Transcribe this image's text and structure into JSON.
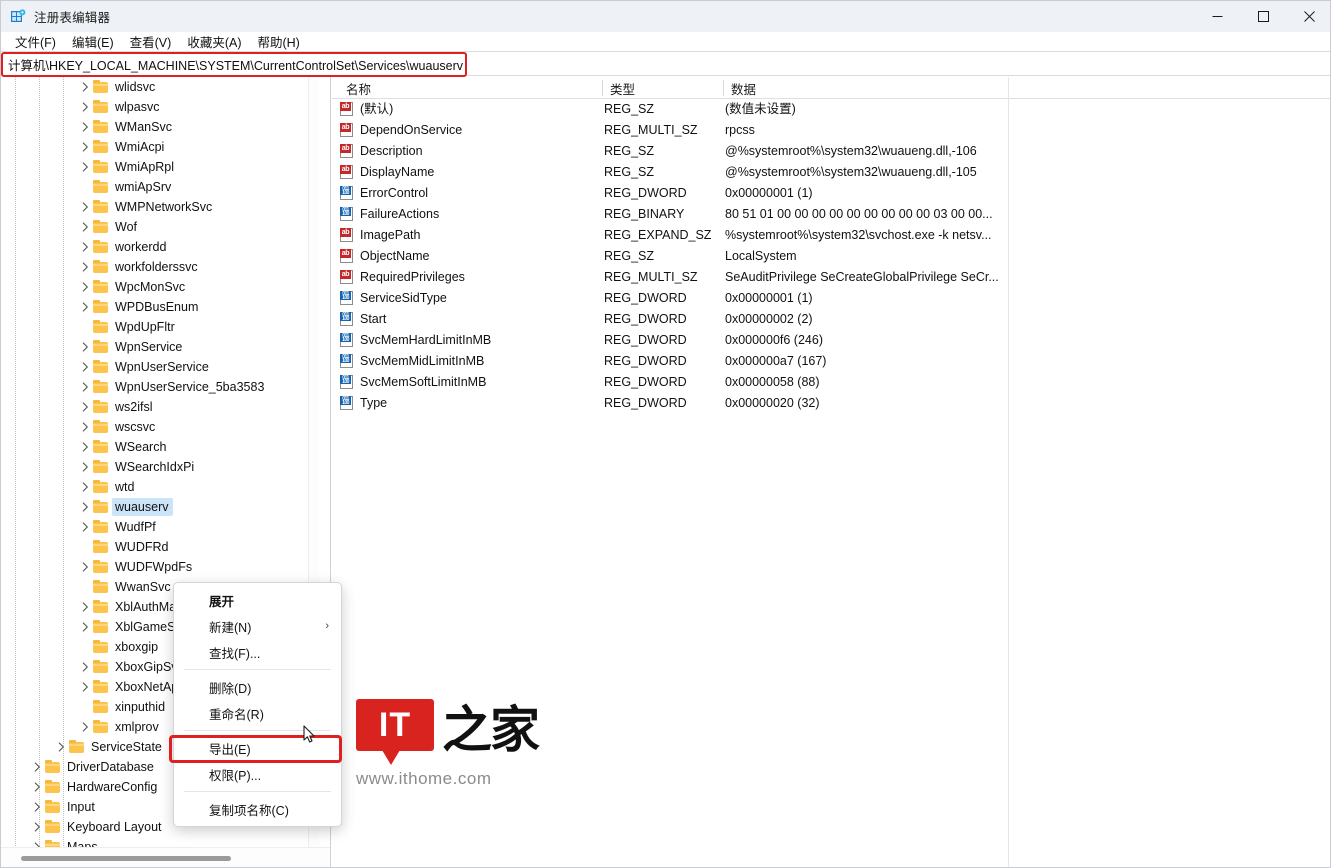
{
  "window": {
    "title": "注册表编辑器",
    "icon": "registry-editor-icon",
    "controls": {
      "minimize": "—",
      "maximize": "▢",
      "close": "✕"
    }
  },
  "menubar": {
    "items": [
      {
        "label": "文件(F)",
        "name": "menu-file"
      },
      {
        "label": "编辑(E)",
        "name": "menu-edit"
      },
      {
        "label": "查看(V)",
        "name": "menu-view"
      },
      {
        "label": "收藏夹(A)",
        "name": "menu-favorites"
      },
      {
        "label": "帮助(H)",
        "name": "menu-help"
      }
    ]
  },
  "address": {
    "value": "计算机\\HKEY_LOCAL_MACHINE\\SYSTEM\\CurrentControlSet\\Services\\wuauserv",
    "placeholder": "",
    "highlight_color": "#e02020"
  },
  "tree": {
    "nodes": [
      {
        "label": "wlidsvc",
        "depth": 3,
        "expandable": true,
        "selected": false
      },
      {
        "label": "wlpasvc",
        "depth": 3,
        "expandable": true,
        "selected": false
      },
      {
        "label": "WManSvc",
        "depth": 3,
        "expandable": true,
        "selected": false
      },
      {
        "label": "WmiAcpi",
        "depth": 3,
        "expandable": true,
        "selected": false
      },
      {
        "label": "WmiApRpl",
        "depth": 3,
        "expandable": true,
        "selected": false
      },
      {
        "label": "wmiApSrv",
        "depth": 3,
        "expandable": false,
        "selected": false
      },
      {
        "label": "WMPNetworkSvc",
        "depth": 3,
        "expandable": true,
        "selected": false
      },
      {
        "label": "Wof",
        "depth": 3,
        "expandable": true,
        "selected": false
      },
      {
        "label": "workerdd",
        "depth": 3,
        "expandable": true,
        "selected": false
      },
      {
        "label": "workfolderssvc",
        "depth": 3,
        "expandable": true,
        "selected": false
      },
      {
        "label": "WpcMonSvc",
        "depth": 3,
        "expandable": true,
        "selected": false
      },
      {
        "label": "WPDBusEnum",
        "depth": 3,
        "expandable": true,
        "selected": false
      },
      {
        "label": "WpdUpFltr",
        "depth": 3,
        "expandable": false,
        "selected": false
      },
      {
        "label": "WpnService",
        "depth": 3,
        "expandable": true,
        "selected": false
      },
      {
        "label": "WpnUserService",
        "depth": 3,
        "expandable": true,
        "selected": false
      },
      {
        "label": "WpnUserService_5ba3583",
        "depth": 3,
        "expandable": true,
        "selected": false
      },
      {
        "label": "ws2ifsl",
        "depth": 3,
        "expandable": true,
        "selected": false
      },
      {
        "label": "wscsvc",
        "depth": 3,
        "expandable": true,
        "selected": false
      },
      {
        "label": "WSearch",
        "depth": 3,
        "expandable": true,
        "selected": false
      },
      {
        "label": "WSearchIdxPi",
        "depth": 3,
        "expandable": true,
        "selected": false
      },
      {
        "label": "wtd",
        "depth": 3,
        "expandable": true,
        "selected": false
      },
      {
        "label": "wuauserv",
        "depth": 3,
        "expandable": true,
        "selected": true
      },
      {
        "label": "WudfPf",
        "depth": 3,
        "expandable": true,
        "selected": false
      },
      {
        "label": "WUDFRd",
        "depth": 3,
        "expandable": false,
        "selected": false
      },
      {
        "label": "WUDFWpdFs",
        "depth": 3,
        "expandable": true,
        "selected": false
      },
      {
        "label": "WwanSvc",
        "depth": 3,
        "expandable": false,
        "selected": false
      },
      {
        "label": "XblAuthManager",
        "depth": 3,
        "expandable": true,
        "selected": false
      },
      {
        "label": "XblGameSave",
        "depth": 3,
        "expandable": true,
        "selected": false
      },
      {
        "label": "xboxgip",
        "depth": 3,
        "expandable": false,
        "selected": false
      },
      {
        "label": "XboxGipSvc",
        "depth": 3,
        "expandable": true,
        "selected": false
      },
      {
        "label": "XboxNetApiSvc",
        "depth": 3,
        "expandable": true,
        "selected": false
      },
      {
        "label": "xinputhid",
        "depth": 3,
        "expandable": false,
        "selected": false
      },
      {
        "label": "xmlprov",
        "depth": 3,
        "expandable": true,
        "selected": false
      },
      {
        "label": "ServiceState",
        "depth": 2,
        "expandable": true,
        "selected": false
      },
      {
        "label": "DriverDatabase",
        "depth": 1,
        "expandable": true,
        "selected": false
      },
      {
        "label": "HardwareConfig",
        "depth": 1,
        "expandable": true,
        "selected": false
      },
      {
        "label": "Input",
        "depth": 1,
        "expandable": true,
        "selected": false
      },
      {
        "label": "Keyboard Layout",
        "depth": 1,
        "expandable": true,
        "selected": false
      },
      {
        "label": "Maps",
        "depth": 1,
        "expandable": true,
        "selected": false
      }
    ]
  },
  "values": {
    "columns": {
      "name": "名称",
      "type": "类型",
      "data": "数据"
    },
    "rows": [
      {
        "name": "(默认)",
        "type": "REG_SZ",
        "data": "(数值未设置)",
        "icon": "string-value-icon"
      },
      {
        "name": "DependOnService",
        "type": "REG_MULTI_SZ",
        "data": "rpcss",
        "icon": "string-value-icon"
      },
      {
        "name": "Description",
        "type": "REG_SZ",
        "data": "@%systemroot%\\system32\\wuaueng.dll,-106",
        "icon": "string-value-icon"
      },
      {
        "name": "DisplayName",
        "type": "REG_SZ",
        "data": "@%systemroot%\\system32\\wuaueng.dll,-105",
        "icon": "string-value-icon"
      },
      {
        "name": "ErrorControl",
        "type": "REG_DWORD",
        "data": "0x00000001 (1)",
        "icon": "binary-value-icon"
      },
      {
        "name": "FailureActions",
        "type": "REG_BINARY",
        "data": "80 51 01 00 00 00 00 00 00 00 00 00 03 00 00...",
        "icon": "binary-value-icon"
      },
      {
        "name": "ImagePath",
        "type": "REG_EXPAND_SZ",
        "data": "%systemroot%\\system32\\svchost.exe -k netsv...",
        "icon": "string-value-icon"
      },
      {
        "name": "ObjectName",
        "type": "REG_SZ",
        "data": "LocalSystem",
        "icon": "string-value-icon"
      },
      {
        "name": "RequiredPrivileges",
        "type": "REG_MULTI_SZ",
        "data": "SeAuditPrivilege SeCreateGlobalPrivilege SeCr...",
        "icon": "string-value-icon"
      },
      {
        "name": "ServiceSidType",
        "type": "REG_DWORD",
        "data": "0x00000001 (1)",
        "icon": "binary-value-icon"
      },
      {
        "name": "Start",
        "type": "REG_DWORD",
        "data": "0x00000002 (2)",
        "icon": "binary-value-icon"
      },
      {
        "name": "SvcMemHardLimitInMB",
        "type": "REG_DWORD",
        "data": "0x000000f6 (246)",
        "icon": "binary-value-icon"
      },
      {
        "name": "SvcMemMidLimitInMB",
        "type": "REG_DWORD",
        "data": "0x000000a7 (167)",
        "icon": "binary-value-icon"
      },
      {
        "name": "SvcMemSoftLimitInMB",
        "type": "REG_DWORD",
        "data": "0x00000058 (88)",
        "icon": "binary-value-icon"
      },
      {
        "name": "Type",
        "type": "REG_DWORD",
        "data": "0x00000020 (32)",
        "icon": "binary-value-icon"
      }
    ]
  },
  "context_menu": {
    "items": [
      {
        "label": "展开",
        "name": "ctx-expand",
        "bold": true,
        "submenu": false,
        "separator_after": false
      },
      {
        "label": "新建(N)",
        "name": "ctx-new",
        "bold": false,
        "submenu": true,
        "separator_after": false
      },
      {
        "label": "查找(F)...",
        "name": "ctx-find",
        "bold": false,
        "submenu": false,
        "separator_after": true
      },
      {
        "label": "删除(D)",
        "name": "ctx-delete",
        "bold": false,
        "submenu": false,
        "separator_after": false
      },
      {
        "label": "重命名(R)",
        "name": "ctx-rename",
        "bold": false,
        "submenu": false,
        "separator_after": true
      },
      {
        "label": "导出(E)",
        "name": "ctx-export",
        "bold": false,
        "submenu": false,
        "separator_after": false
      },
      {
        "label": "权限(P)...",
        "name": "ctx-permissions",
        "bold": false,
        "submenu": false,
        "separator_after": true
      },
      {
        "label": "复制项名称(C)",
        "name": "ctx-copy-key-name",
        "bold": false,
        "submenu": false,
        "separator_after": false
      }
    ],
    "submenu_arrow": "›",
    "highlighted_item": "导出(E)",
    "highlight_color": "#e02020"
  },
  "watermark": {
    "badge_text": "IT",
    "cn_text": "之家",
    "url": "www.ithome.com",
    "badge_color": "#d8231f"
  }
}
